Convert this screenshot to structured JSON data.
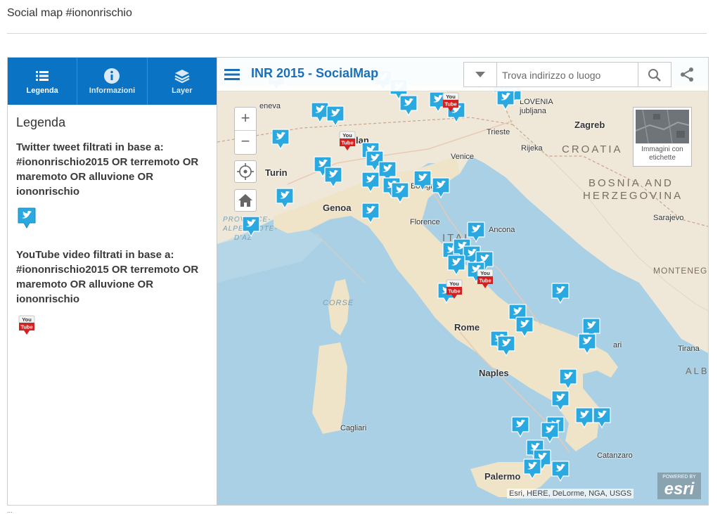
{
  "page": {
    "title": "Social map #iononrischio",
    "footnote": "..."
  },
  "tabs": [
    {
      "label": "Legenda",
      "icon": "list-icon",
      "active": true
    },
    {
      "label": "Informazioni",
      "icon": "info-icon",
      "active": false
    },
    {
      "label": "Layer",
      "icon": "layers-icon",
      "active": false
    }
  ],
  "panel": {
    "heading": "Legenda",
    "twitter_text": "Twitter tweet filtrati in base a: #iononrischio2015 OR terremoto OR maremoto OR alluvione OR iononrischio",
    "youtube_text": "YouTube video filtrati in base a: #iononrischio2015 OR terremoto OR maremoto OR alluvione OR iononrischio"
  },
  "map": {
    "title": "INR 2015 - SocialMap",
    "search_placeholder": "Trova indirizzo o luogo",
    "zoom_in": "+",
    "zoom_out": "−",
    "basemap_label": "Immagini con etichette",
    "attribution": "Esri, HERE, DeLorme, NGA, USGS",
    "esri_powered": "POWERED BY",
    "esri_logo": "esri",
    "colors": {
      "sea": "#a9d0e4",
      "land": "#efe8d8",
      "italy": "#efe3c8",
      "accent": "#0b73c3",
      "twitter": "#2aa9e0",
      "youtube": "#d32020"
    },
    "cities": {
      "turin": "Turin",
      "milan": "lan",
      "genoa": "Genoa",
      "bologna": "Bologna",
      "florence": "Florence",
      "venice": "Venice",
      "trieste": "Trieste",
      "rijeka": "Rijeka",
      "zagreb": "Zagreb",
      "ancona": "Ancona",
      "rome": "Rome",
      "naples": "Naples",
      "cagliari": "Cagliari",
      "palermo": "Palermo",
      "catanzaro": "Catanzaro",
      "bari": "ari",
      "sarajevo": "Sarajevo",
      "tirana": "Tirana",
      "ljubljana": "jubljana",
      "geneva": "eneva",
      "slovenia": "LOVENIA"
    },
    "regions": {
      "italy": "ITALY",
      "croatia": "CROATIA",
      "bih1": "BOSNIA AND",
      "bih2": "HERZEGOVINA",
      "montenegro": "MONTENEG",
      "corse": "CORSE",
      "provence1": "PROVENCE-",
      "provence2": "ALPES-COTE-",
      "provence3": "D'AZ",
      "alb": "ALB"
    }
  }
}
